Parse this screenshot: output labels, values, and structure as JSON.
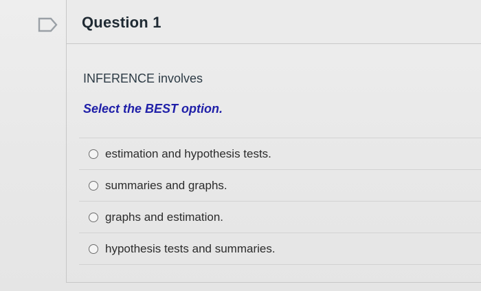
{
  "question": {
    "title": "Question 1",
    "text": "INFERENCE involves",
    "instruction": "Select the BEST option.",
    "options": [
      {
        "label": "estimation and hypothesis tests."
      },
      {
        "label": "summaries and graphs."
      },
      {
        "label": "graphs and estimation."
      },
      {
        "label": "hypothesis tests and summaries."
      }
    ]
  },
  "colors": {
    "instruction": "#1f1fa8",
    "background": "#ebebeb",
    "flag": "#9aa0a6"
  },
  "icons": {
    "flag": "flag-icon"
  }
}
